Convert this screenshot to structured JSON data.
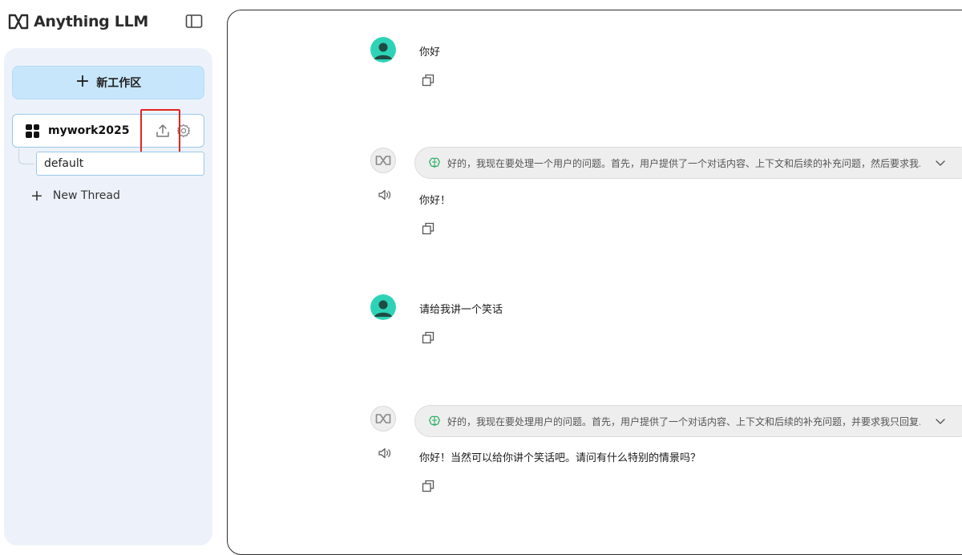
{
  "app": {
    "name": "Anything LLM"
  },
  "sidebar": {
    "new_workspace_label": "新工作区",
    "workspace": {
      "name": "mywork2025"
    },
    "threads": [
      {
        "name": "default"
      }
    ],
    "new_thread_label": "New Thread"
  },
  "chat": {
    "messages": [
      {
        "role": "user",
        "text": "你好"
      },
      {
        "role": "assistant",
        "thought": "好的，我现在要处理一个用户的问题。首先，用户提供了一个对话内容、上下文和后续的补充问题，然后要求我...",
        "text": "你好！"
      },
      {
        "role": "user",
        "text": "请给我讲一个笑话"
      },
      {
        "role": "assistant",
        "thought": "好的，我现在要处理用户的问题。首先，用户提供了一个对话内容、上下文和后续的补充问题，并要求我只回复...",
        "text": "你好！当然可以给你讲个笑话吧。请问有什么特别的情景吗？"
      }
    ]
  },
  "colors": {
    "accent": "#c7e6fb",
    "highlight": "#e02424",
    "avatar": "#2ed3b7"
  },
  "icons": [
    "anything-llm-logo",
    "sidebar-toggle-icon",
    "plus-icon",
    "workspace-grid-icon",
    "upload-icon",
    "gear-icon",
    "user-avatar-icon",
    "bot-avatar-icon",
    "brain-icon",
    "chevron-down-icon",
    "speaker-icon",
    "copy-icon"
  ]
}
